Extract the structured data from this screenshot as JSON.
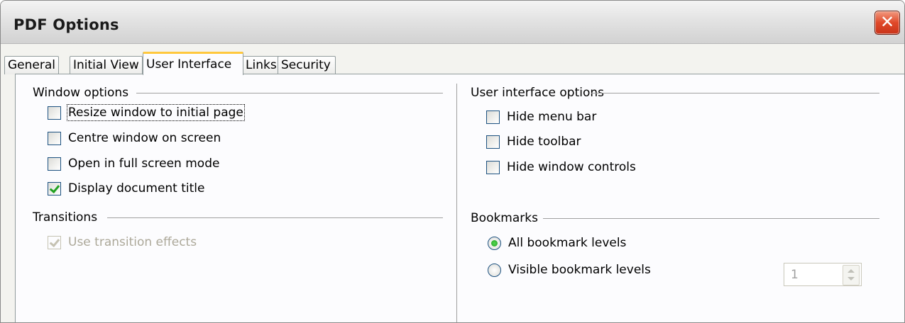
{
  "window": {
    "title": "PDF Options",
    "close_glyph": "✕"
  },
  "tabs": [
    {
      "label": "General",
      "active": false
    },
    {
      "label": "Initial View",
      "active": false
    },
    {
      "label": "User Interface",
      "active": true
    },
    {
      "label": "Links",
      "active": false
    },
    {
      "label": "Security",
      "active": false
    }
  ],
  "window_options": {
    "heading": "Window options",
    "items": [
      {
        "label": "Resize window to initial page",
        "checked": false
      },
      {
        "label": "Centre window on screen",
        "checked": false
      },
      {
        "label": "Open in full screen mode",
        "checked": false
      },
      {
        "label": "Display document title",
        "checked": true
      }
    ]
  },
  "transitions": {
    "heading": "Transitions",
    "items": [
      {
        "label": "Use transition effects",
        "checked": true,
        "enabled": false
      }
    ]
  },
  "ui_options": {
    "heading": "User interface options",
    "items": [
      {
        "label": "Hide menu bar",
        "checked": false
      },
      {
        "label": "Hide toolbar",
        "checked": false
      },
      {
        "label": "Hide window controls",
        "checked": false
      }
    ]
  },
  "bookmarks": {
    "heading": "Bookmarks",
    "options": [
      {
        "label": "All bookmark levels",
        "selected": true
      },
      {
        "label": "Visible bookmark levels",
        "selected": false
      }
    ],
    "levels_value": "1"
  },
  "colors": {
    "accent_tab": "#ffc83c",
    "check_green": "#21a121",
    "close_red": "#e0492a"
  }
}
